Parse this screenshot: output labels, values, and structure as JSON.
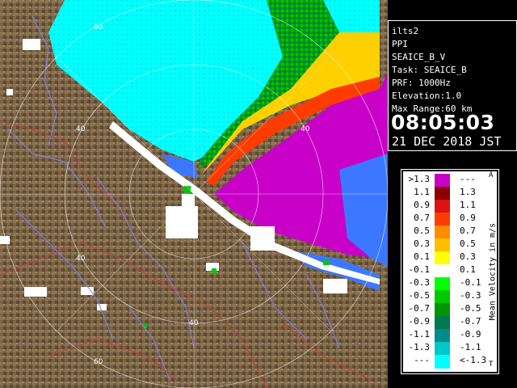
{
  "info": {
    "site": "ilts2",
    "mode": "PPI",
    "product": "SEAICE_B_V",
    "task": "Task: SEAICE_B",
    "prf": "PRF: 1000Hz",
    "elevation": "Elevation:1.0",
    "max_range": "Max Range:60 km",
    "time": "08:05:03",
    "date": "21 DEC 2018 JST"
  },
  "legend": {
    "title": "Mean Velocity in m/s",
    "top_marker": "A",
    "bottom_marker": "T",
    "rows": [
      {
        "left": ">1.3",
        "right": "---",
        "color": "#c800c8"
      },
      {
        "left": "1.1",
        "right": "1.3",
        "color": "#8c0000"
      },
      {
        "left": "0.9",
        "right": "1.1",
        "color": "#dc1414"
      },
      {
        "left": "0.7",
        "right": "0.9",
        "color": "#ff3c00"
      },
      {
        "left": "0.5",
        "right": "0.7",
        "color": "#ff8c00"
      },
      {
        "left": "0.3",
        "right": "0.5",
        "color": "#ffbe00"
      },
      {
        "left": "0.1",
        "right": "0.3",
        "color": "#ffff00"
      },
      {
        "left": "-0.1",
        "right": "0.1",
        "color": "#ffffff"
      },
      {
        "left": "-0.3",
        "right": "-0.1",
        "color": "#00ff00"
      },
      {
        "left": "-0.5",
        "right": "-0.3",
        "color": "#00c800"
      },
      {
        "left": "-0.7",
        "right": "-0.5",
        "color": "#009600"
      },
      {
        "left": "-0.9",
        "right": "-0.7",
        "color": "#007850"
      },
      {
        "left": "-1.1",
        "right": "-0.9",
        "color": "#008c8c"
      },
      {
        "left": "-1.3",
        "right": "-1.1",
        "color": "#00c8c8"
      },
      {
        "left": "---",
        "right": "<-1.3",
        "color": "#00ffff"
      }
    ]
  },
  "range_labels": [
    "60",
    "40",
    "40",
    "40",
    "40",
    "60"
  ],
  "colors": {
    "land": "#7a6346",
    "sea_cyan": "#00ffff",
    "far_blue": "#3c78ff",
    "approach_magenta": "#c800c8",
    "river": "#8080ff",
    "boundary": "#c83c3c"
  }
}
